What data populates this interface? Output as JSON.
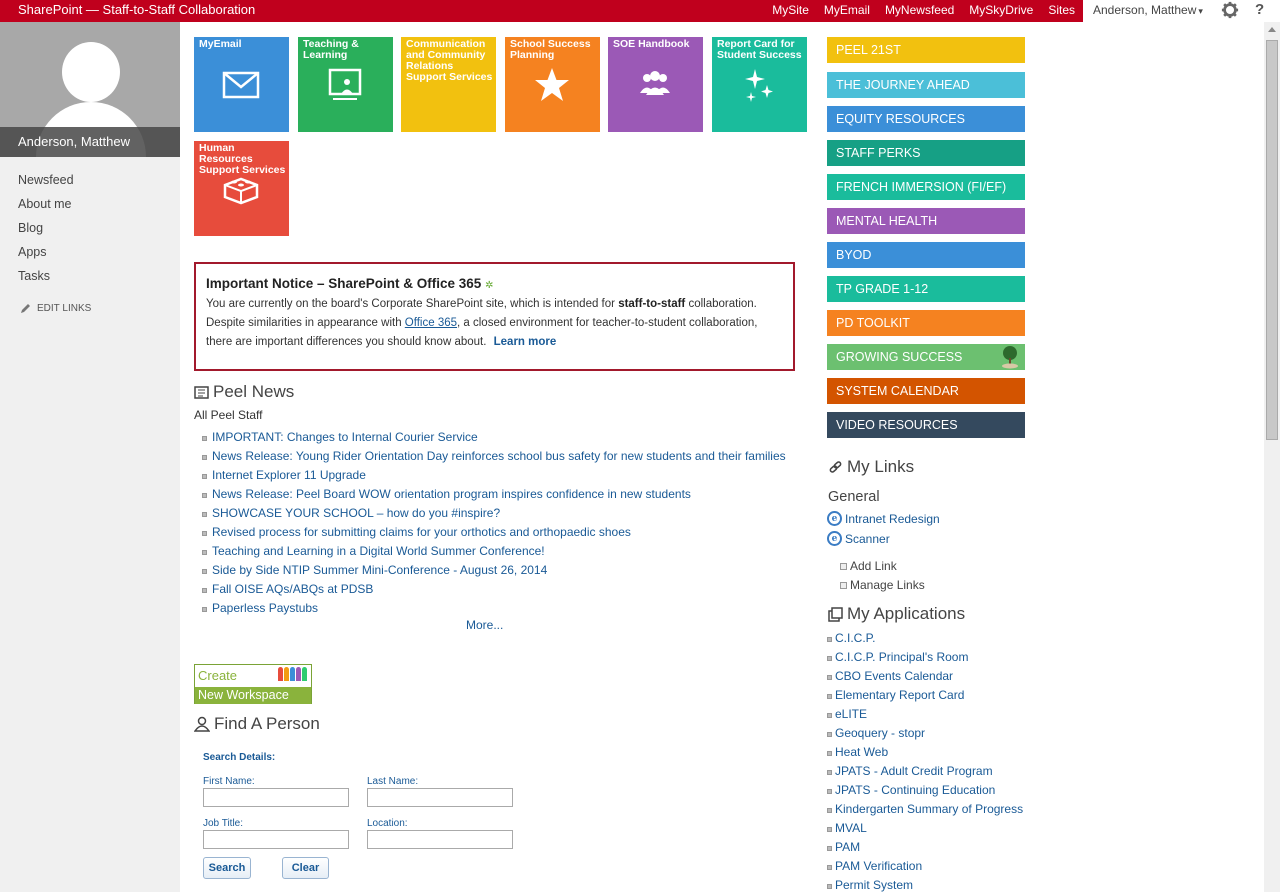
{
  "topbar": {
    "brand": "SharePoint — Staff-to-Staff Collaboration",
    "nav": [
      "MySite",
      "MyEmail",
      "MyNewsfeed",
      "MySkyDrive",
      "Sites"
    ],
    "user": "Anderson, Matthew",
    "help": "?"
  },
  "profile": {
    "name": "Anderson, Matthew"
  },
  "leftnav": {
    "items": [
      "Newsfeed",
      "About me",
      "Blog",
      "Apps",
      "Tasks"
    ],
    "edit_links": "EDIT LINKS"
  },
  "tiles": [
    {
      "label": "MyEmail",
      "color": "#3b8fd8",
      "icon": "envelope-icon"
    },
    {
      "label": "Teaching & Learning",
      "color": "#2aaf5b",
      "icon": "presentation-icon"
    },
    {
      "label": "Communication and Community Relations Support Services",
      "color": "#f2c10f",
      "icon": ""
    },
    {
      "label": "School Success Planning",
      "color": "#f58220",
      "icon": "star-icon"
    },
    {
      "label": "SOE Handbook",
      "color": "#9b59b6",
      "icon": "group-icon"
    },
    {
      "label": "Report Card for Student Success",
      "color": "#1abc9c",
      "icon": "sparkle-icon"
    },
    {
      "label": "Human Resources Support Services",
      "color": "#e74c3c",
      "icon": "lego-icon"
    }
  ],
  "notice": {
    "title": "Important Notice – SharePoint & Office 365",
    "line1_pre": "You are currently on the board's Corporate SharePoint site, which is intended for ",
    "line1_bold": "staff-to-staff",
    "line1_post": " collaboration.",
    "line2_pre": "Despite similarities in appearance with ",
    "line2_link": "Office 365",
    "line2_post": ", a closed environment for teacher-to-student collaboration,",
    "line3": "there are important differences you should know about.",
    "learn_more": "Learn more"
  },
  "news": {
    "heading": "Peel News",
    "subheading": "All Peel Staff",
    "items": [
      "IMPORTANT: Changes to Internal Courier Service",
      "News Release: Young Rider Orientation Day reinforces school bus safety for new students and their families",
      "Internet Explorer 11 Upgrade",
      "News Release: Peel Board WOW orientation program inspires confidence in new students",
      "SHOWCASE YOUR SCHOOL – how do you #inspire?",
      "Revised process for submitting claims for your orthotics and orthopaedic shoes",
      "Teaching and Learning in a Digital World Summer Conference!",
      "Side by Side NTIP Summer Mini-Conference - August 26, 2014",
      "Fall OISE AQs/ABQs at PDSB",
      "Paperless Paystubs"
    ],
    "more": "More..."
  },
  "create_workspace": {
    "line1": "Create",
    "line2": "New Workspace"
  },
  "find_person": {
    "heading": "Find A Person",
    "search_details": "Search Details:",
    "first_name": "First Name:",
    "last_name": "Last Name:",
    "job_title": "Job Title:",
    "location": "Location:",
    "search_btn": "Search",
    "clear_btn": "Clear"
  },
  "right_bars": [
    {
      "label": "PEEL 21ST",
      "color": "#f2c10f"
    },
    {
      "label": "THE JOURNEY AHEAD",
      "color": "#4bbfd8"
    },
    {
      "label": "EQUITY RESOURCES",
      "color": "#3b8fd8"
    },
    {
      "label": "STAFF PERKS",
      "color": "#16a085"
    },
    {
      "label": "FRENCH IMMERSION (FI/EF)",
      "color": "#1abc9c"
    },
    {
      "label": "MENTAL HEALTH",
      "color": "#9b59b6"
    },
    {
      "label": "BYOD",
      "color": "#3b8fd8"
    },
    {
      "label": "TP GRADE 1-12",
      "color": "#1abc9c"
    },
    {
      "label": "PD TOOLKIT",
      "color": "#f58220"
    },
    {
      "label": "GROWING SUCCESS",
      "color": "#6cc070"
    },
    {
      "label": "SYSTEM CALENDAR",
      "color": "#d35400"
    },
    {
      "label": "VIDEO RESOURCES",
      "color": "#34495e"
    }
  ],
  "my_links": {
    "heading": "My Links",
    "group": "General",
    "links": [
      "Intranet Redesign",
      "Scanner"
    ],
    "add_link": "Add Link",
    "manage_links": "Manage Links"
  },
  "my_apps": {
    "heading": "My Applications",
    "items": [
      "C.I.C.P.",
      "C.I.C.P. Principal's Room",
      "CBO Events Calendar",
      "Elementary Report Card",
      "eLITE",
      "Geoquery - stopr",
      "Heat Web",
      "JPATS - Adult Credit Program",
      "JPATS - Continuing Education",
      "Kindergarten Summary of Progress",
      "MVAL",
      "PAM",
      "PAM Verification",
      "Permit System"
    ]
  }
}
